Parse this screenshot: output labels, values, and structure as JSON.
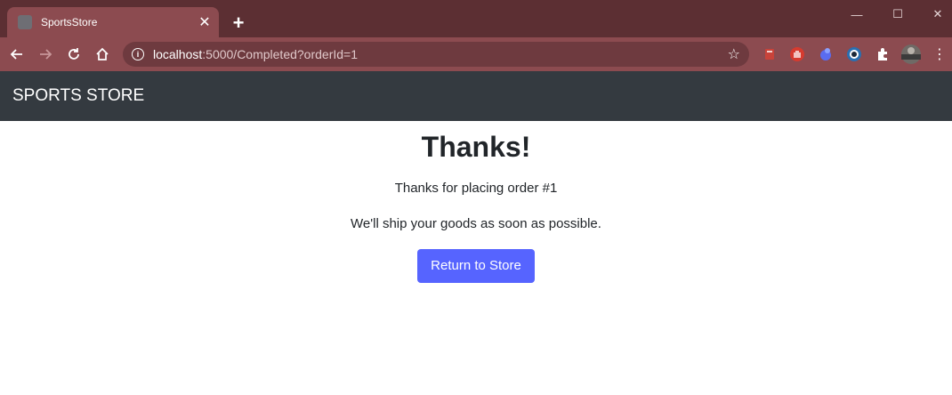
{
  "browser": {
    "tab_title": "SportsStore",
    "tab_close": "✕",
    "new_tab": "+",
    "window_controls": {
      "minimize": "—",
      "maximize": "☐",
      "close": "✕"
    },
    "url_host": "localhost",
    "url_rest": ":5000/Completed?orderId=1",
    "icons": [
      "back-icon",
      "forward-icon",
      "reload-icon",
      "home-icon",
      "info-icon",
      "star-icon",
      "extension-icons",
      "avatar"
    ],
    "colors": {
      "tabstrip": "#5c2f33",
      "toolbar": "#8c4b50",
      "omnibox": "#6e3a3f"
    }
  },
  "page": {
    "brand": "SPORTS STORE",
    "heading": "Thanks!",
    "order_message": "Thanks for placing order #1",
    "ship_message": "We'll ship your goods as soon as possible.",
    "return_button": "Return to Store",
    "colors": {
      "navbar": "#343a40",
      "button": "#5664ff",
      "text": "#212529"
    }
  }
}
